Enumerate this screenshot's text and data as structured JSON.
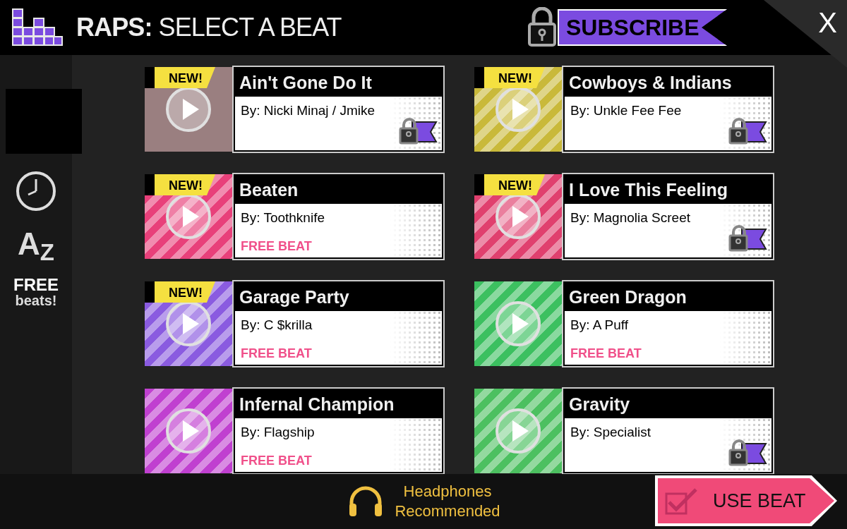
{
  "header": {
    "title": "**RAPS:** SELECT A BEAT",
    "subscribe": "SUBSCRIBE",
    "close": "X"
  },
  "sidebar": {
    "items": [
      {
        "kind": "blank"
      },
      {
        "kind": "clock"
      },
      {
        "kind": "sort",
        "label": "A$_{Z}$"
      },
      {
        "kind": "free",
        "label": "FREE",
        "sublabel": "beats!"
      }
    ]
  },
  "beats": [
    {
      "title": "Ain't Gone Do It",
      "artist": "By: Nicki Minaj / Jmike",
      "new": true,
      "new_label": "NEW!",
      "kind": "locked",
      "art": {
        "kind": "photo"
      }
    },
    {
      "title": "Cowboys & Indians",
      "artist": "By: Unkle Fee Fee",
      "new": true,
      "new_label": "NEW!",
      "kind": "locked",
      "art": {
        "kind": "stripes",
        "color": "#c9b93a"
      }
    },
    {
      "title": "Beaten",
      "artist": "By: Toothknife",
      "new": true,
      "new_label": "NEW!",
      "kind": "free",
      "free_label": "FREE BEAT",
      "art": {
        "kind": "stripes",
        "color": "#e8407a"
      }
    },
    {
      "title": "I Love This Feeling",
      "artist": "By: Magnolia Screet",
      "new": true,
      "new_label": "NEW!",
      "kind": "locked",
      "art": {
        "kind": "stripes",
        "color": "#e0406e"
      }
    },
    {
      "title": "Garage Party",
      "artist": "By: C $krilla",
      "new": true,
      "new_label": "NEW!",
      "kind": "free",
      "free_label": "FREE BEAT",
      "art": {
        "kind": "stripes",
        "color": "#8a5be0"
      }
    },
    {
      "title": "Green Dragon",
      "artist": "By: A Puff",
      "new": false,
      "kind": "free",
      "free_label": "FREE BEAT",
      "art": {
        "kind": "stripes",
        "color": "#3cc060"
      }
    },
    {
      "title": "Infernal Champion",
      "artist": "By: Flagship",
      "new": false,
      "kind": "free",
      "free_label": "FREE BEAT",
      "art": {
        "kind": "stripes",
        "color": "#c040d0"
      }
    },
    {
      "title": "Gravity",
      "artist": "By: Specialist",
      "new": false,
      "kind": "locked",
      "art": {
        "kind": "stripes",
        "color": "#4cc060"
      }
    }
  ],
  "footer": {
    "hint": "Headphones Recommended",
    "button": "USE BEAT"
  }
}
